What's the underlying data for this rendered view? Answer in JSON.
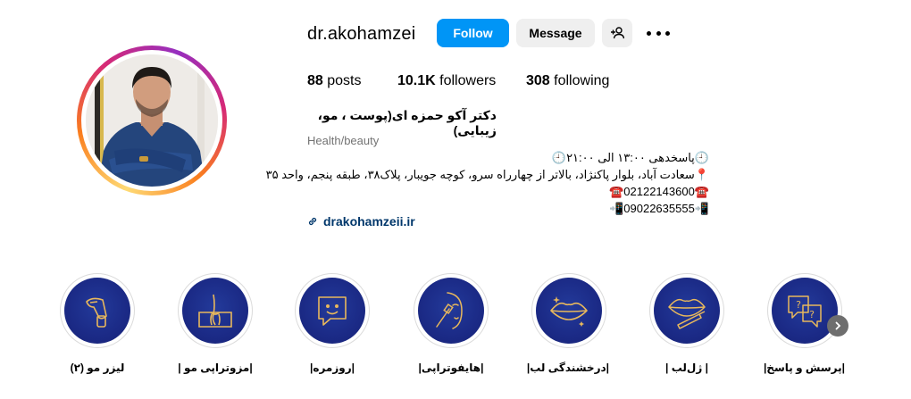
{
  "profile": {
    "username": "dr.akohamzei",
    "follow_label": "Follow",
    "message_label": "Message",
    "stats": {
      "posts_count": "88",
      "posts_label": "posts",
      "followers_count": "10.1K",
      "followers_label": "followers",
      "following_count": "308",
      "following_label": "following"
    },
    "full_name": "دکتر آکو حمزه ای(پوست ، مو، زیبایی)",
    "category": "Health/beauty",
    "bio": [
      "🕘پاسخدهی ۱۳:۰۰ الی ۲۱:۰۰🕘",
      "📍سعادت آباد، بلوار پاکنژاد، بالاتر از چهارراه سرو، کوچه جویبار، پلاک۳۸، طبقه پنجم، واحد ۳۵",
      "☎️02122143600☎️",
      "📲09022635555📲"
    ],
    "link": "drakohamzeii.ir"
  },
  "highlights": [
    {
      "label": "لیزر مو (۲)",
      "icon": "laser-device-icon"
    },
    {
      "label": "|مزوتراپی مو |",
      "icon": "hair-follicle-icon"
    },
    {
      "label": "|روزمره|",
      "icon": "chat-smile-icon"
    },
    {
      "label": "|هایفوتراپی|",
      "icon": "face-device-icon"
    },
    {
      "label": "|درخشندگی لب|",
      "icon": "lips-icon"
    },
    {
      "label": "| ژل‌لب |",
      "icon": "lips-syringe-icon"
    },
    {
      "label": "|پرسش و پاسخ|",
      "icon": "question-chat-icon"
    }
  ],
  "colors": {
    "accent": "#0095f6",
    "highlight_bg": "#1b2a86",
    "highlight_line": "#e8b85c",
    "link": "#00376b"
  }
}
